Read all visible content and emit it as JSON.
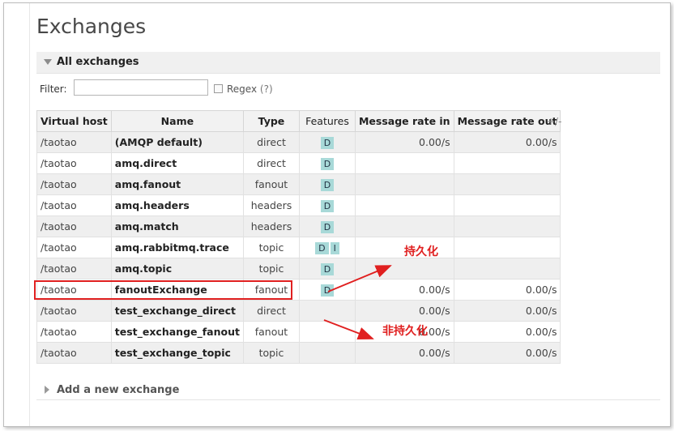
{
  "page": {
    "title": "Exchanges"
  },
  "section": {
    "label": "All exchanges",
    "add_label": "Add a new exchange"
  },
  "filter": {
    "label": "Filter:",
    "value": "",
    "regex_label": "Regex",
    "regex_help": "(?)"
  },
  "table": {
    "headers": [
      "Virtual host",
      "Name",
      "Type",
      "Features",
      "Message rate in",
      "Message rate out"
    ],
    "columns_toggle": "+/-",
    "rows": [
      {
        "vhost": "/taotao",
        "name": "(AMQP default)",
        "type": "direct",
        "features": [
          "D"
        ],
        "rate_in": "0.00/s",
        "rate_out": "0.00/s"
      },
      {
        "vhost": "/taotao",
        "name": "amq.direct",
        "type": "direct",
        "features": [
          "D"
        ],
        "rate_in": "",
        "rate_out": ""
      },
      {
        "vhost": "/taotao",
        "name": "amq.fanout",
        "type": "fanout",
        "features": [
          "D"
        ],
        "rate_in": "",
        "rate_out": ""
      },
      {
        "vhost": "/taotao",
        "name": "amq.headers",
        "type": "headers",
        "features": [
          "D"
        ],
        "rate_in": "",
        "rate_out": ""
      },
      {
        "vhost": "/taotao",
        "name": "amq.match",
        "type": "headers",
        "features": [
          "D"
        ],
        "rate_in": "",
        "rate_out": ""
      },
      {
        "vhost": "/taotao",
        "name": "amq.rabbitmq.trace",
        "type": "topic",
        "features": [
          "D",
          "I"
        ],
        "rate_in": "",
        "rate_out": ""
      },
      {
        "vhost": "/taotao",
        "name": "amq.topic",
        "type": "topic",
        "features": [
          "D"
        ],
        "rate_in": "",
        "rate_out": ""
      },
      {
        "vhost": "/taotao",
        "name": "fanoutExchange",
        "type": "fanout",
        "features": [
          "D"
        ],
        "rate_in": "0.00/s",
        "rate_out": "0.00/s"
      },
      {
        "vhost": "/taotao",
        "name": "test_exchange_direct",
        "type": "direct",
        "features": [],
        "rate_in": "0.00/s",
        "rate_out": "0.00/s"
      },
      {
        "vhost": "/taotao",
        "name": "test_exchange_fanout",
        "type": "fanout",
        "features": [],
        "rate_in": "0.00/s",
        "rate_out": "0.00/s"
      },
      {
        "vhost": "/taotao",
        "name": "test_exchange_topic",
        "type": "topic",
        "features": [],
        "rate_in": "0.00/s",
        "rate_out": "0.00/s"
      }
    ]
  },
  "annotations": {
    "durable": "持久化",
    "non_durable": "非持久化"
  },
  "colors": {
    "annotation": "#e02020",
    "badge": "#a8d9d8"
  }
}
